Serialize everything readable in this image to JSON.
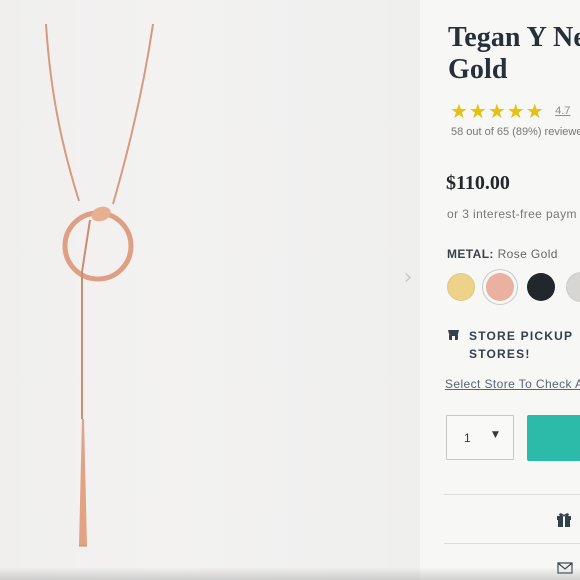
{
  "product": {
    "title_line_1": "Tegan Y Ne",
    "title_line_2": "Gold",
    "stars": "★★★★★",
    "rating": "4.7",
    "review_summary": "58 out of 65 (89%) reviewe",
    "price": "$110.00",
    "installments": "or 3 interest-free paym",
    "metal_label": "METAL:",
    "metal_value": "Rose Gold"
  },
  "swatches": [
    {
      "name": "gold",
      "color": "#efd28a"
    },
    {
      "name": "rose-gold",
      "color": "#eab0a0",
      "selected": true
    },
    {
      "name": "black",
      "color": "#22272d"
    },
    {
      "name": "silver",
      "color": "#d8d6d2"
    }
  ],
  "pickup": {
    "line_1": "STORE PICKUP",
    "line_2": "STORES!",
    "select_store": "Select Store To Check A"
  },
  "purchase": {
    "quantity": "1",
    "quantity_arrow": "▼",
    "accent_color": "#2dbba9"
  },
  "icons": {
    "gallery_next": "chevron-right-icon",
    "store": "store-icon",
    "gift": "gift-icon",
    "mail": "mail-icon"
  },
  "gallery": {
    "next_arrow": "›"
  }
}
